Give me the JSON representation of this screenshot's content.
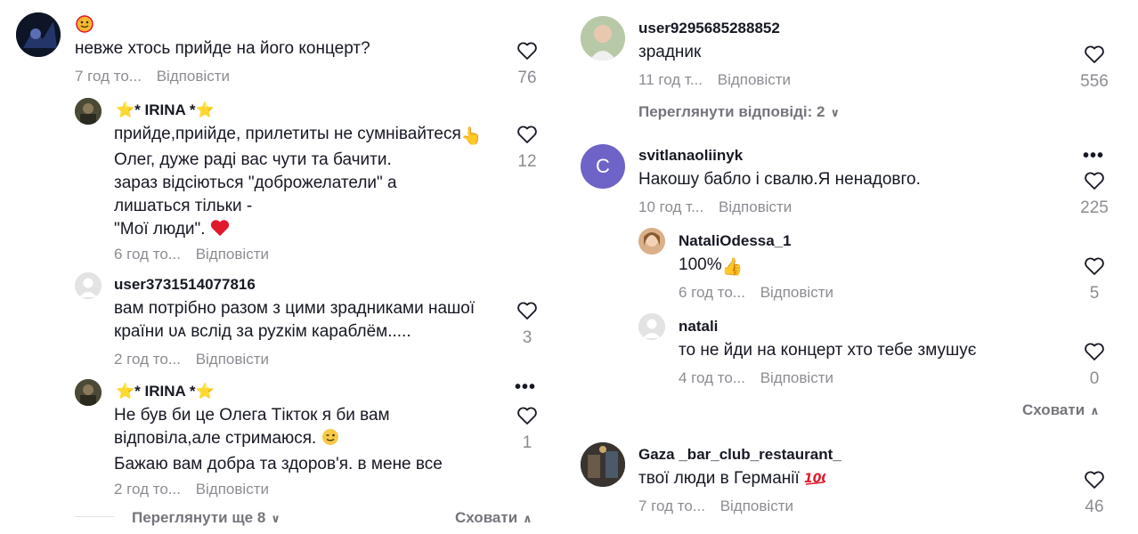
{
  "left_column": {
    "main_comment": {
      "username_emoji": "emoji-face",
      "text": "невже хтось прийде на його концерт?",
      "time": "7 год то...",
      "reply_label": "Відповісти",
      "likes": "76"
    },
    "replies": [
      {
        "username": "* IRINA *",
        "lines": [
          "прийде,приійде, прилетиты не сумнівайтеся",
          "Олег, дуже раді вас чути та бачити.",
          "зараз відсіються \"доброжелатели\" а",
          "лишаться тільки -",
          "\"Мої люди\"."
        ],
        "time": "6 год то...",
        "reply_label": "Відповісти",
        "likes": "12"
      },
      {
        "username": "user3731514077816",
        "lines": [
          "вам потрібно разом з цими зрадниками нашої",
          "країни ᴜᴀ вслід за руzкім караблём....."
        ],
        "time": "2 год то...",
        "reply_label": "Відповісти",
        "likes": "3"
      },
      {
        "username": "* IRINA *",
        "lines": [
          "Не був би це Олега Тікток я би вам",
          "відповіла,але стримаюся.",
          "Бажаю вам добра та здоров'я. в мене все"
        ],
        "time": "2 год то...",
        "reply_label": "Відповісти",
        "likes": "1"
      }
    ],
    "view_more": "Переглянути ще 8",
    "hide": "Сховати"
  },
  "right_column": {
    "comments": [
      {
        "username": "user9295685288852",
        "text": "зрадник",
        "time": "11 год т...",
        "reply_label": "Відповісти",
        "likes": "556",
        "view_replies": "Переглянути відповіді: 2"
      },
      {
        "username": "svitlanaoliinyk",
        "avatar_letter": "C",
        "text": "Накошу бабло і свалю.Я ненадовго.",
        "time": "10 год т...",
        "reply_label": "Відповісти",
        "likes": "225"
      }
    ],
    "replies": [
      {
        "username": "NataliOdessa_1",
        "text": "100%",
        "time": "6 год то...",
        "reply_label": "Відповісти",
        "likes": "5"
      },
      {
        "username": "natali",
        "text": "то не йди на концерт хто тебе змушує",
        "time": "4 год то...",
        "reply_label": "Відповісти",
        "likes": "0"
      }
    ],
    "hide": "Сховати",
    "last_comment": {
      "username": "Gaza _bar_club_restaurant_",
      "text": "твої люди в Германії",
      "time": "7 год то...",
      "reply_label": "Відповісти",
      "likes": "46"
    }
  },
  "colors": {
    "text": "#161823",
    "muted": "#8a8b91",
    "purple_avatar": "#6e63c7",
    "heart_red": "#e0192c"
  }
}
